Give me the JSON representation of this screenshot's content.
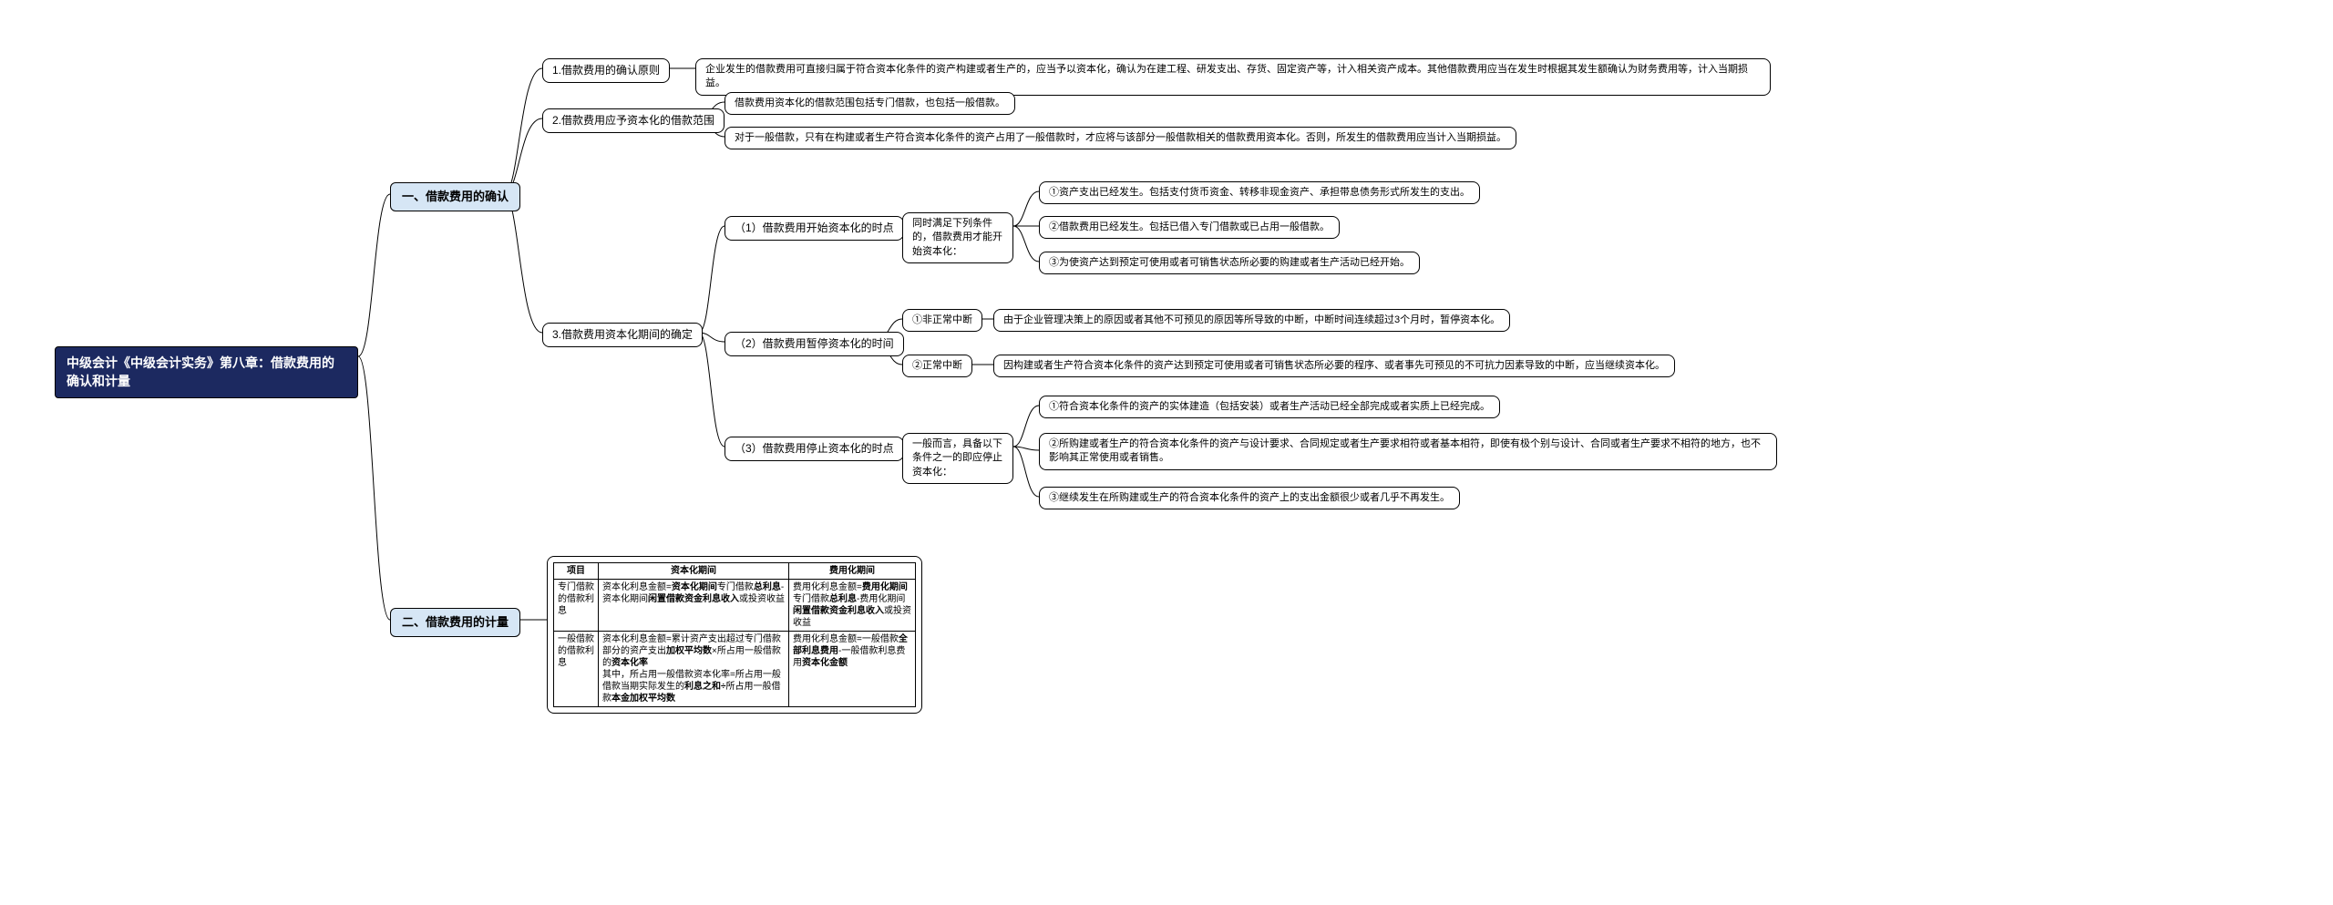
{
  "root": "中级会计《中级会计实务》第八章：借款费用的确认和计量",
  "section1": "一、借款费用的确认",
  "section2": "二、借款费用的计量",
  "s1_1": "1.借款费用的确认原则",
  "s1_1_c": "企业发生的借款费用可直接归属于符合资本化条件的资产构建或者生产的，应当予以资本化，确认为在建工程、研发支出、存货、固定资产等，计入相关资产成本。其他借款费用应当在发生时根据其发生额确认为财务费用等，计入当期损益。",
  "s1_2": "2.借款费用应予资本化的借款范围",
  "s1_2_c1": "借款费用资本化的借款范围包括专门借款，也包括一般借款。",
  "s1_2_c2": "对于一般借款，只有在构建或者生产符合资本化条件的资产占用了一般借款时，才应将与该部分一般借款相关的借款费用资本化。否则，所发生的借款费用应当计入当期损益。",
  "s1_3": "3.借款费用资本化期间的确定",
  "s1_3_1": "（1）借款费用开始资本化的时点",
  "s1_3_1_t": "同时满足下列条件的，借款费用才能开始资本化：",
  "s1_3_1_c1": "①资产支出已经发生。包括支付货币资金、转移非现金资产、承担带息债务形式所发生的支出。",
  "s1_3_1_c2": "②借款费用已经发生。包括已借入专门借款或已占用一般借款。",
  "s1_3_1_c3": "③为使资产达到预定可使用或者可销售状态所必要的购建或者生产活动已经开始。",
  "s1_3_2": "（2）借款费用暂停资本化的时间",
  "s1_3_2_a": "①非正常中断",
  "s1_3_2_a_c": "由于企业管理决策上的原因或者其他不可预见的原因等所导致的中断，中断时间连续超过3个月时，暂停资本化。",
  "s1_3_2_b": "②正常中断",
  "s1_3_2_b_c": "因构建或者生产符合资本化条件的资产达到预定可使用或者可销售状态所必要的程序、或者事先可预见的不可抗力因素导致的中断，应当继续资本化。",
  "s1_3_3": "（3）借款费用停止资本化的时点",
  "s1_3_3_t": "一般而言，具备以下条件之一的即应停止资本化：",
  "s1_3_3_c1": "①符合资本化条件的资产的实体建造（包括安装）或者生产活动已经全部完成或者实质上已经完成。",
  "s1_3_3_c2": "②所购建或者生产的符合资本化条件的资产与设计要求、合同规定或者生产要求相符或者基本相符，即使有极个别与设计、合同或者生产要求不相符的地方，也不影响其正常使用或者销售。",
  "s1_3_3_c3": "③继续发生在所购建或生产的符合资本化条件的资产上的支出金额很少或者几乎不再发生。",
  "chart_data": {
    "type": "table",
    "title": "借款费用的计量",
    "columns": [
      "项目",
      "资本化期间",
      "费用化期间"
    ],
    "rows": [
      {
        "item": "专门借款的借款利息",
        "cap": "资本化利息金额=资本化期间专门借款总利息-资本化期间闲置借款资金利息收入或投资收益",
        "exp": "费用化利息金额=费用化期间专门借款总利息-费用化期间闲置借款资金利息收入或投资收益"
      },
      {
        "item": "一般借款的借款利息",
        "cap": "资本化利息金额=累计资产支出超过专门借款部分的资产支出加权平均数×所占用一般借款的资本化率\n其中，所占用一般借款资本化率=所占用一般借款当期实际发生的利息之和÷所占用一般借款本金加权平均数",
        "exp": "费用化利息金额=一般借款全部利息费用-一般借款利息费用资本化金额"
      }
    ]
  },
  "tbl": {
    "h1": "项目",
    "h2": "资本化期间",
    "h3": "费用化期间",
    "r1c1": "专门借款的借款利息",
    "r1c2a": "资本化利息金额=",
    "r1c2b": "资本化期间",
    "r1c2c": "专门借款",
    "r1c2d": "总利息",
    "r1c2e": "-资本化期间",
    "r1c2f": "闲置借款资金利息收入",
    "r1c2g": "或投资收益",
    "r1c3a": "费用化利息金额=",
    "r1c3b": "费用化期间",
    "r1c3c": "专门借款",
    "r1c3d": "总利息",
    "r1c3e": "-费用化期间",
    "r1c3f": "闲置借款资金利息收入",
    "r1c3g": "或投资收益",
    "r2c1": "一般借款的借款利息",
    "r2c2a": "资本化利息金额=累计资产支出超过专门借款部分的资产支出",
    "r2c2b": "加权平均数",
    "r2c2c": "×所占用一般借款的",
    "r2c2d": "资本化率",
    "r2c2e": "其中，所占用一般借款资本化率=所占用一般借款当期实际发生的",
    "r2c2f": "利息之和÷",
    "r2c2g": "所占用一般借款",
    "r2c2h": "本金加权平均数",
    "r2c3a": "费用化利息金额=一般借款",
    "r2c3b": "全部利息费用",
    "r2c3c": "-一般借款利息费用",
    "r2c3d": "资本化金额"
  }
}
